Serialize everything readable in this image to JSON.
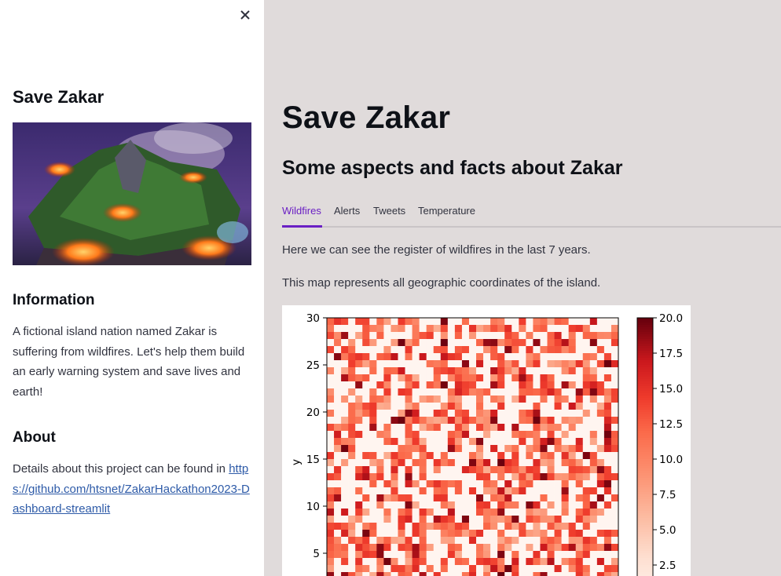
{
  "sidebar": {
    "title": "Save Zakar",
    "information_heading": "Information",
    "information_text": "A fictional island nation named Zakar is suffering from wildfires. Let's help them build an early warning system and save lives and earth!",
    "about_heading": "About",
    "about_text": "Details about this project can be found in",
    "about_link": "https://github.com/htsnet/ZakarHackathon2023-Dashboard-streamlit",
    "image_icon": "burning-island-image",
    "close_icon": "close-icon"
  },
  "main": {
    "title": "Save Zakar",
    "subtitle": "Some aspects and facts about Zakar",
    "tabs": [
      {
        "label": "Wildfires",
        "active": true
      },
      {
        "label": "Alerts",
        "active": false
      },
      {
        "label": "Tweets",
        "active": false
      },
      {
        "label": "Temperature",
        "active": false
      }
    ],
    "paragraph1": "Here we can see the register of wildfires in the last 7 years.",
    "paragraph2": "This map represents all geographic coordinates of the island."
  },
  "colors": {
    "accent": "#6a1fc4",
    "main_bg": "#e0dbdb",
    "link": "#2e5ba8"
  },
  "chart_data": {
    "type": "heatmap",
    "ylabel": "y",
    "xlabel": "",
    "y_ticks": [
      "30",
      "25",
      "20",
      "15",
      "10",
      "5"
    ],
    "ylim": [
      0,
      30
    ],
    "colorbar_ticks": [
      "20.0",
      "17.5",
      "15.0",
      "12.5",
      "10.0",
      "7.5",
      "5.0",
      "2.5"
    ],
    "colorbar_range": [
      0,
      20
    ],
    "colormap": "Reds",
    "grid": false
  }
}
